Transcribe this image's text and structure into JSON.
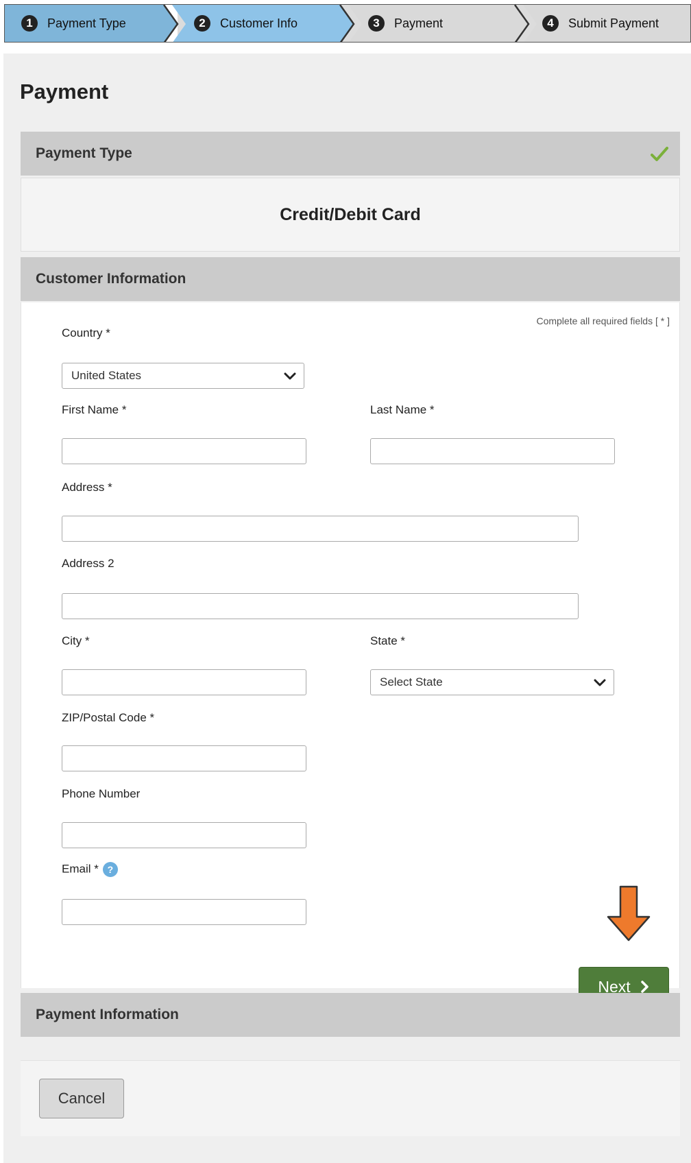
{
  "steps": [
    {
      "number": "1",
      "label": "Payment Type"
    },
    {
      "number": "2",
      "label": "Customer Info"
    },
    {
      "number": "3",
      "label": "Payment"
    },
    {
      "number": "4",
      "label": "Submit Payment"
    }
  ],
  "page_title": "Payment",
  "payment_type": {
    "header": "Payment Type",
    "selected": "Credit/Debit Card",
    "status_icon": "check-icon"
  },
  "customer_info": {
    "header": "Customer Information",
    "required_note": "Complete all required fields [ * ]",
    "fields": {
      "country": {
        "label": "Country *",
        "value": "United States"
      },
      "first_name": {
        "label": "First Name *",
        "value": ""
      },
      "last_name": {
        "label": "Last Name *",
        "value": ""
      },
      "address": {
        "label": "Address *",
        "value": ""
      },
      "address2": {
        "label": "Address 2",
        "value": ""
      },
      "city": {
        "label": "City *",
        "value": ""
      },
      "state": {
        "label": "State *",
        "value": "Select State"
      },
      "zip": {
        "label": "ZIP/Postal Code *",
        "value": ""
      },
      "phone": {
        "label": "Phone Number",
        "value": ""
      },
      "email": {
        "label": "Email *",
        "value": "",
        "help": "?"
      }
    },
    "next_label": "Next"
  },
  "payment_info": {
    "header": "Payment Information"
  },
  "cancel_label": "Cancel",
  "colors": {
    "step_done": "#7fb5d9",
    "step_current": "#8ec3e8",
    "step_pending": "#d9d9d9",
    "next_button": "#4f7d3a",
    "check": "#7bb03a",
    "annotation_arrow": "#ee7a2c"
  }
}
